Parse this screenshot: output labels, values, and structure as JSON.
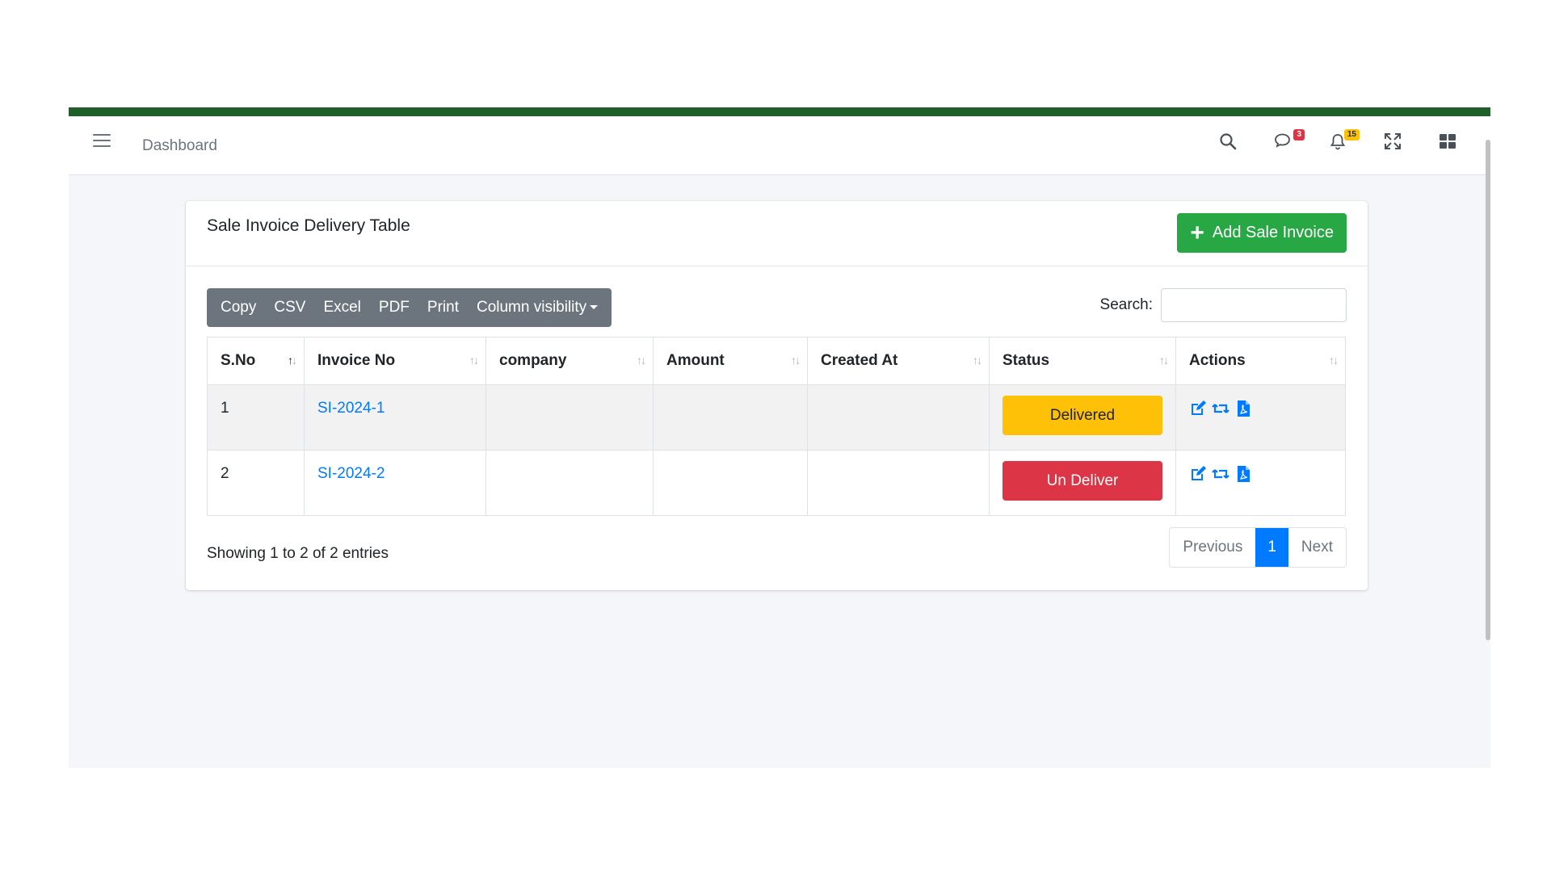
{
  "navbar": {
    "title": "Dashboard",
    "messages_badge": "3",
    "notifications_badge": "15"
  },
  "card": {
    "title": "Sale Invoice Delivery Table",
    "add_button": "Add Sale Invoice"
  },
  "toolbar": {
    "copy": "Copy",
    "csv": "CSV",
    "excel": "Excel",
    "pdf": "PDF",
    "print": "Print",
    "column_visibility": "Column visibility"
  },
  "search": {
    "label": "Search:",
    "value": ""
  },
  "table": {
    "headers": [
      "S.No",
      "Invoice No",
      "company",
      "Amount",
      "Created At",
      "Status",
      "Actions"
    ],
    "rows": [
      {
        "sno": "1",
        "invoice": "SI-2024-1",
        "company": "",
        "amount": "",
        "created_at": "",
        "status": "Delivered"
      },
      {
        "sno": "2",
        "invoice": "SI-2024-2",
        "company": "",
        "amount": "",
        "created_at": "",
        "status": "Un Deliver"
      }
    ]
  },
  "footer": {
    "info": "Showing 1 to 2 of 2 entries",
    "previous": "Previous",
    "page": "1",
    "next": "Next"
  },
  "colors": {
    "accent_bar": "#1f5f2a",
    "add_button": "#28a745",
    "delivered": "#ffc107",
    "undeliver": "#dc3545",
    "link": "#007bff"
  },
  "icons": [
    "hamburger-icon",
    "search-icon",
    "comments-icon",
    "bell-icon",
    "expand-icon",
    "grid-icon",
    "plus-icon",
    "edit-icon",
    "retweet-icon",
    "pdf-file-icon"
  ]
}
